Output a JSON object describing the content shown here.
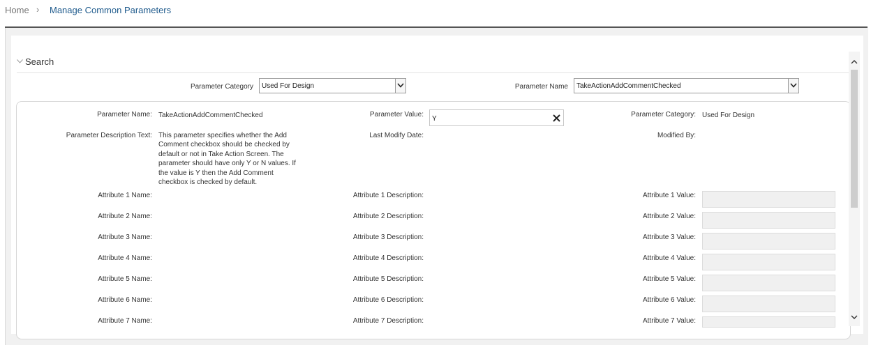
{
  "breadcrumb": {
    "home": "Home",
    "separator": "›",
    "current": "Manage Common Parameters"
  },
  "search": {
    "title": "Search",
    "category_label": "Parameter Category",
    "category_value": "Used For Design",
    "name_label": "Parameter Name",
    "name_value": "TakeActionAddCommentChecked"
  },
  "details": {
    "param_name_label": "Parameter Name:",
    "param_name_value": "TakeActionAddCommentChecked",
    "param_value_label": "Parameter Value:",
    "param_value": "Y",
    "param_category_label": "Parameter Category:",
    "param_category_value": "Used For Design",
    "desc_label": "Parameter Description Text:",
    "desc_value": "This parameter specifies whether the Add Comment checkbox should be checked by default or not in Take Action Screen. The parameter should have only Y or N values. If the value is Y then the Add Comment checkbox is checked by default.",
    "last_modify_label": "Last Modify Date:",
    "modified_by_label": "Modified By:",
    "attributes": [
      {
        "name_label": "Attribute 1 Name:",
        "desc_label": "Attribute 1 Description:",
        "value_label": "Attribute 1 Value:"
      },
      {
        "name_label": "Attribute 2 Name:",
        "desc_label": "Attribute 2 Description:",
        "value_label": "Attribute 2 Value:"
      },
      {
        "name_label": "Attribute 3 Name:",
        "desc_label": "Attribute 3 Description:",
        "value_label": "Attribute 3 Value:"
      },
      {
        "name_label": "Attribute 4 Name:",
        "desc_label": "Attribute 4 Description:",
        "value_label": "Attribute 4 Value:"
      },
      {
        "name_label": "Attribute 5 Name:",
        "desc_label": "Attribute 5 Description:",
        "value_label": "Attribute 5 Value:"
      },
      {
        "name_label": "Attribute 6 Name:",
        "desc_label": "Attribute 6 Description:",
        "value_label": "Attribute 6 Value:"
      },
      {
        "name_label": "Attribute 7 Name:",
        "desc_label": "Attribute 7 Description:",
        "value_label": "Attribute 7 Value:"
      }
    ]
  },
  "icons": {
    "breadcrumb_separator": "chevron-right-icon",
    "collapse": "chevron-down-icon",
    "select_arrow": "chevron-down-icon",
    "clear": "close-icon",
    "scroll_up": "chevron-up-icon",
    "scroll_down": "chevron-down-icon"
  },
  "colors": {
    "link": "#1e5a8c",
    "panel_bg": "#f1f1f1",
    "readonly_field": "#f0f0f0"
  }
}
